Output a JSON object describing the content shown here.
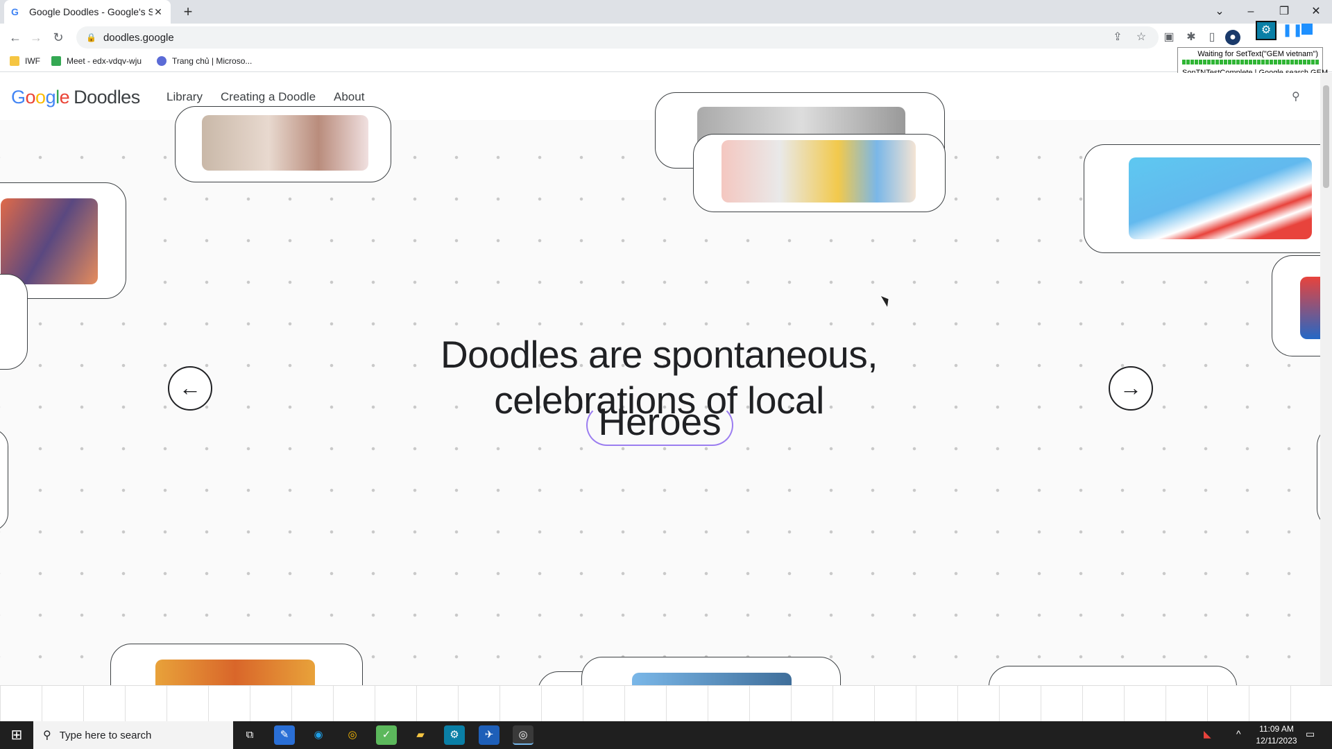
{
  "browser": {
    "tab_title": "Google Doodles - Google's Sear",
    "tab_favicon": "G",
    "tab_close": "✕",
    "new_tab": "+",
    "url": "doodles.google",
    "bookmarks": [
      {
        "label": "IWF",
        "color": "#f5c542"
      },
      {
        "label": "Meet - edx-vdqv-wju",
        "color": "#34a853"
      },
      {
        "label": "Trang chủ | Microso...",
        "color": "#5b6bd6"
      }
    ]
  },
  "overlay": {
    "status": "Waiting for SetText(\"GEM vietnam\")",
    "progress": 1.0,
    "caption": "SonTNTestComplete | Google search GEM"
  },
  "site": {
    "logo_parts": [
      "G",
      "o",
      "o",
      "g",
      "l",
      "e"
    ],
    "logo_suffix": "Doodles",
    "nav": [
      "Library",
      "Creating a Doodle",
      "About"
    ]
  },
  "hero": {
    "line1": "Doodles are spontaneous,",
    "line2": "celebrations of local",
    "highlight": "Heroes",
    "prev": "←",
    "next": "→"
  },
  "taskbar": {
    "search_placeholder": "Type here to search",
    "time": "11:09 AM",
    "date": "12/11/2023"
  },
  "colors": {
    "accent": "#9b7df0",
    "google_blue": "#4285f4",
    "google_red": "#ea4335",
    "google_yellow": "#fbbc05",
    "google_green": "#34a853"
  }
}
